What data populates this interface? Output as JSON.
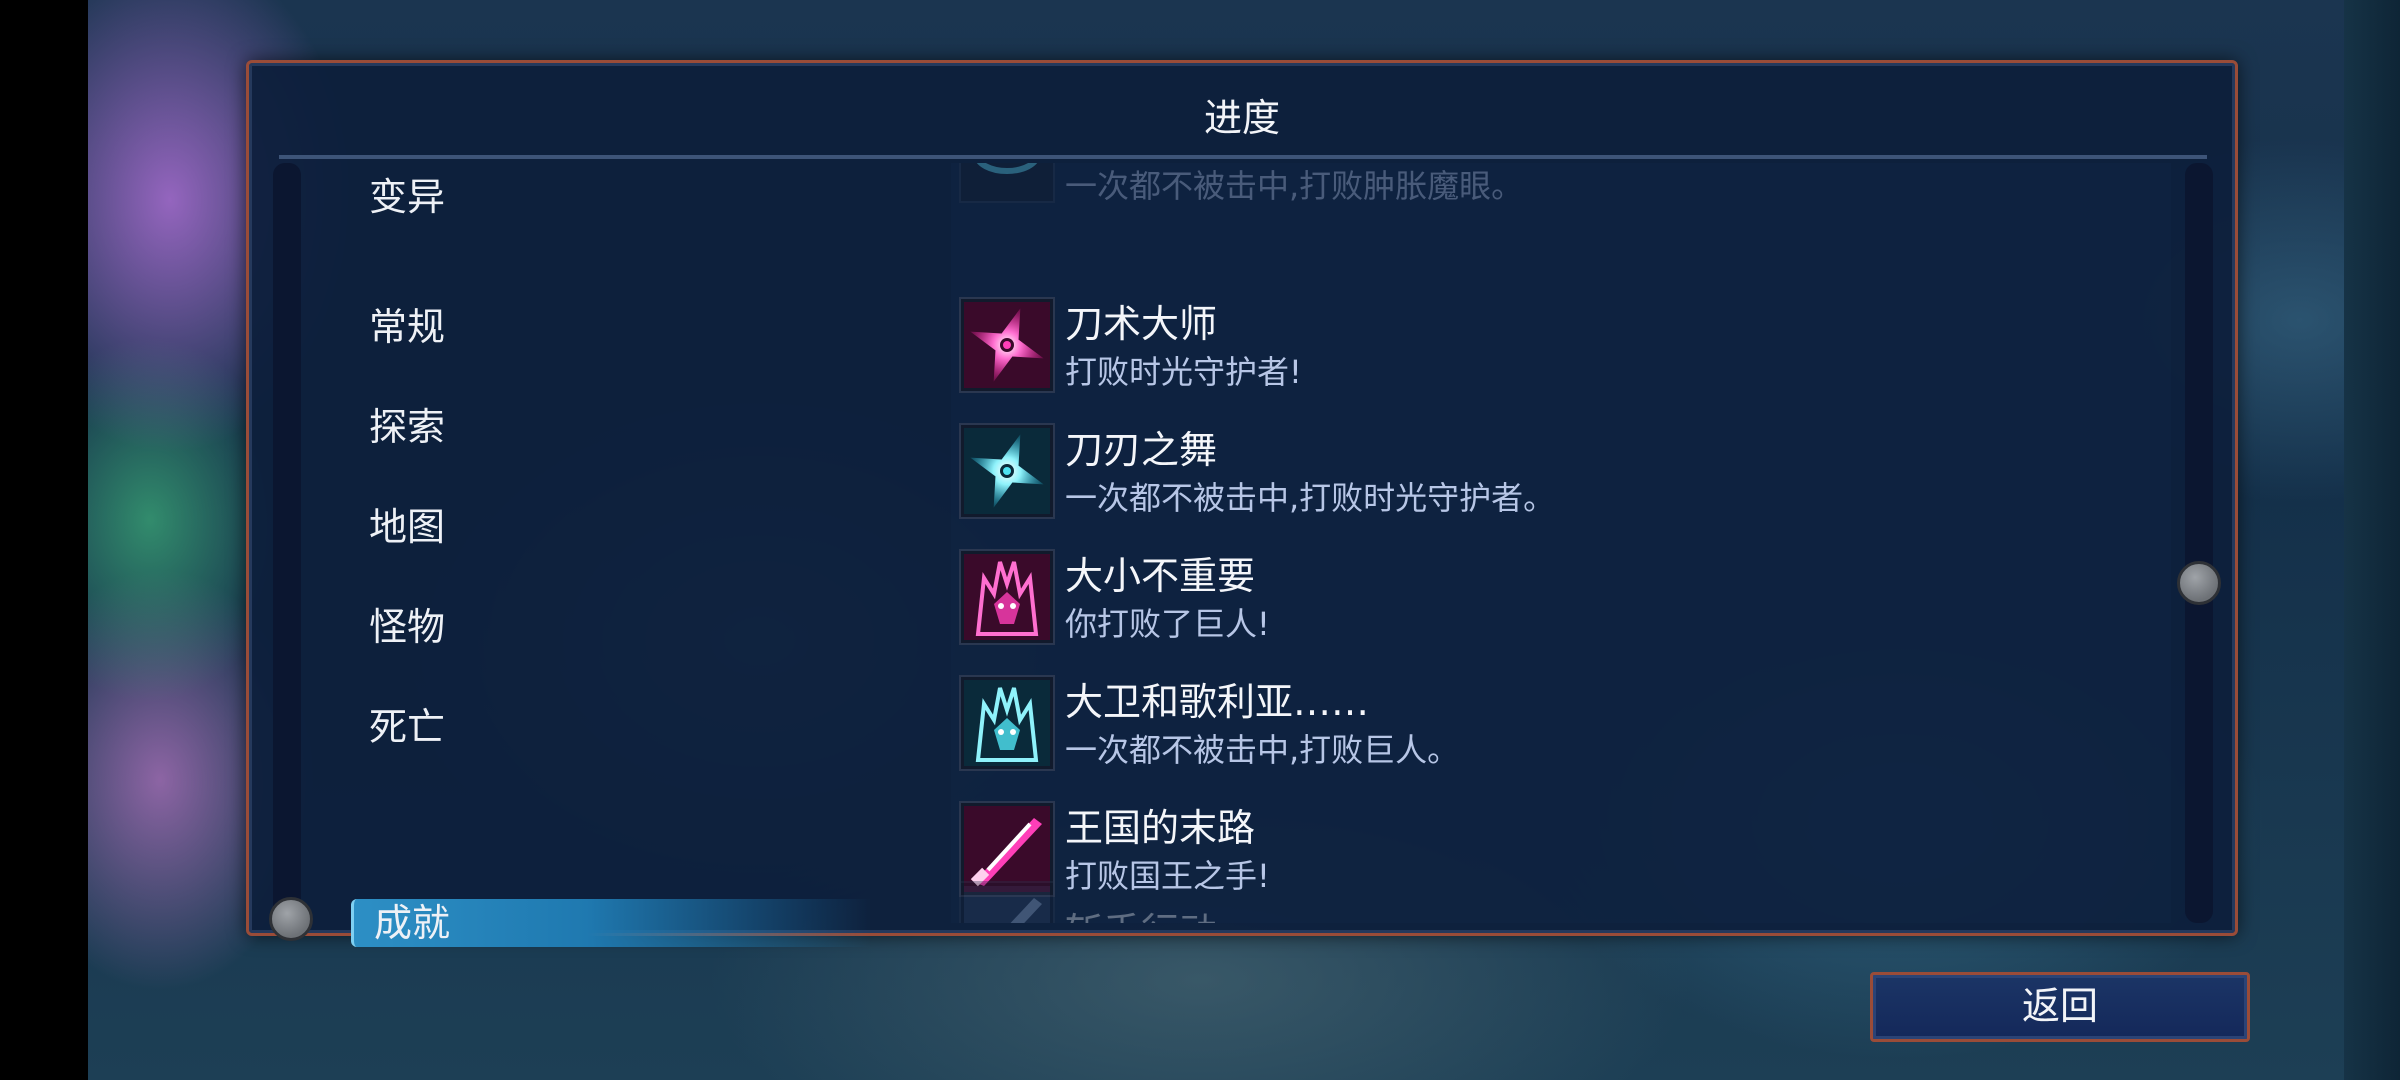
{
  "panel": {
    "title": "进度"
  },
  "categories": [
    {
      "label": "变异",
      "active": false
    },
    {
      "label": "常规",
      "active": false
    },
    {
      "label": "探索",
      "active": false
    },
    {
      "label": "地图",
      "active": false
    },
    {
      "label": "怪物",
      "active": false
    },
    {
      "label": "死亡",
      "active": false
    },
    {
      "label": "成就",
      "active": true
    }
  ],
  "achievements": [
    {
      "name": "",
      "desc": "一次都不被击中,打败肿胀魔眼。",
      "icon": "eye-icon",
      "color": "#5fd6ec"
    },
    {
      "name": "刀术大师",
      "desc": "打败时光守护者!",
      "icon": "shuriken-icon",
      "color": "#ff3fb8"
    },
    {
      "name": "刀刃之舞",
      "desc": "一次都不被击中,打败时光守护者。",
      "icon": "shuriken-icon",
      "color": "#4fe3f2"
    },
    {
      "name": "大小不重要",
      "desc": "你打败了巨人!",
      "icon": "giant-icon",
      "color": "#ff3fb8"
    },
    {
      "name": "大卫和歌利亚……",
      "desc": "一次都不被击中,打败巨人。",
      "icon": "giant-icon",
      "color": "#4fe3f2"
    },
    {
      "name": "王国的末路",
      "desc": "打败国王之手!",
      "icon": "blade-icon",
      "color": "#ff3fb8"
    },
    {
      "name": "斩手行动",
      "desc": "",
      "icon": "blade-icon",
      "color": "#9bb4d8"
    }
  ],
  "footer": {
    "back_label": "返回"
  }
}
